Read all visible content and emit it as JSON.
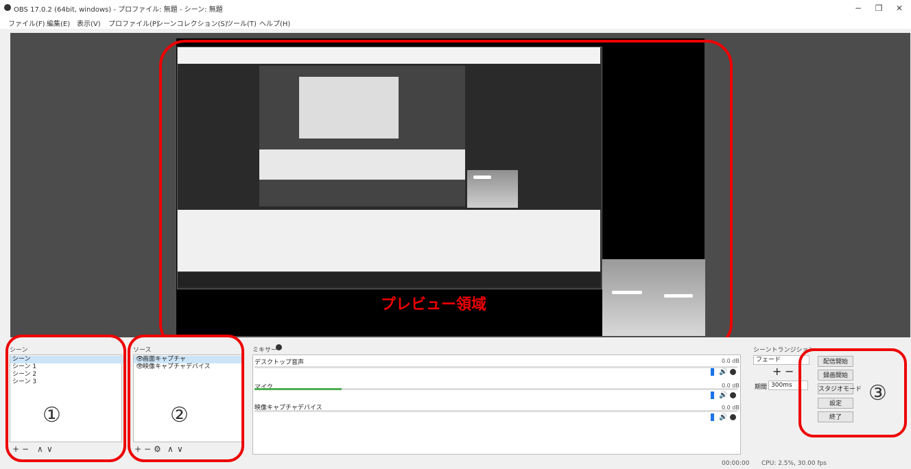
{
  "window": {
    "title": "OBS 17.0.2 (64bit, windows) - プロファイル: 無題 - シーン: 無題",
    "minimize": "−",
    "maximize": "❐",
    "close": "✕"
  },
  "menu": [
    "ファイル(F)",
    "編集(E)",
    "表示(V)",
    "プロファイル(P)",
    "シーンコレクション(S)",
    "ツール(T)",
    "ヘルプ(H)"
  ],
  "preview": {
    "label": "プレビュー領域"
  },
  "scenes": {
    "title": "シーン",
    "items": [
      "シーン",
      "シーン 1",
      "シーン 2",
      "シーン 3"
    ],
    "selected_index": 0,
    "toolbar": {
      "add": "+",
      "remove": "−",
      "up": "∧",
      "down": "∨"
    }
  },
  "sources": {
    "title": "ソース",
    "items": [
      "画面キャプチャ",
      "映像キャプチャデバイス"
    ],
    "selected_index": 0,
    "toolbar": {
      "add": "+",
      "remove": "−",
      "gear": "⚙",
      "up": "∧",
      "down": "∨"
    }
  },
  "mixer": {
    "title": "ミキサー",
    "channels": [
      {
        "name": "デスクトップ音声",
        "db": "0.0 dB",
        "level": 0.0
      },
      {
        "name": "マイク",
        "db": "0.0 dB",
        "level": 0.18
      },
      {
        "name": "映像キャプチャデバイス",
        "db": "0.0 dB",
        "level": 0.0
      }
    ]
  },
  "transitions": {
    "title": "シーントランジション",
    "type": "フェード",
    "add": "+",
    "remove": "−",
    "duration_label": "期間",
    "duration_value": "300ms"
  },
  "controls": {
    "buttons": [
      "配信開始",
      "録画開始",
      "スタジオモード",
      "設定",
      "終了"
    ]
  },
  "status": {
    "time": "00:00:00",
    "cpu": "CPU: 2.5%, 30.00 fps"
  },
  "annotations": {
    "one": "①",
    "two": "②",
    "three": "③"
  },
  "colors": {
    "annotation_red": "#e00000",
    "accent_blue": "#1a73e8",
    "meter_green": "#4caf50"
  }
}
